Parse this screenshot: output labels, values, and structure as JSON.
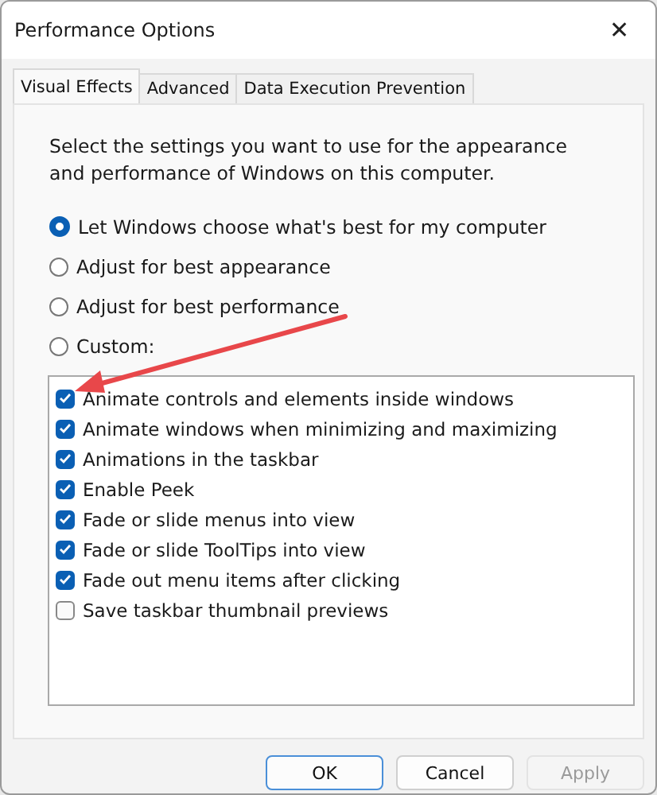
{
  "window": {
    "title": "Performance Options",
    "close": "✕"
  },
  "tabs": [
    {
      "label": "Visual Effects",
      "selected": true
    },
    {
      "label": "Advanced",
      "selected": false
    },
    {
      "label": "Data Execution Prevention",
      "selected": false
    }
  ],
  "intro": "Select the settings you want to use for the appearance and performance of Windows on this computer.",
  "options": [
    {
      "label": "Let Windows choose what's best for my computer",
      "selected": true
    },
    {
      "label": "Adjust for best appearance",
      "selected": false
    },
    {
      "label": "Adjust for best performance",
      "selected": false
    },
    {
      "label": "Custom:",
      "selected": false
    }
  ],
  "effects": [
    {
      "label": "Animate controls and elements inside windows",
      "checked": true
    },
    {
      "label": "Animate windows when minimizing and maximizing",
      "checked": true
    },
    {
      "label": "Animations in the taskbar",
      "checked": true
    },
    {
      "label": "Enable Peek",
      "checked": true
    },
    {
      "label": "Fade or slide menus into view",
      "checked": true
    },
    {
      "label": "Fade or slide ToolTips into view",
      "checked": true
    },
    {
      "label": "Fade out menu items after clicking",
      "checked": true
    },
    {
      "label": "Save taskbar thumbnail previews",
      "checked": false
    }
  ],
  "buttons": [
    {
      "label": "OK",
      "default": true,
      "disabled": false
    },
    {
      "label": "Cancel",
      "default": false,
      "disabled": false
    },
    {
      "label": "Apply",
      "default": false,
      "disabled": true
    }
  ]
}
